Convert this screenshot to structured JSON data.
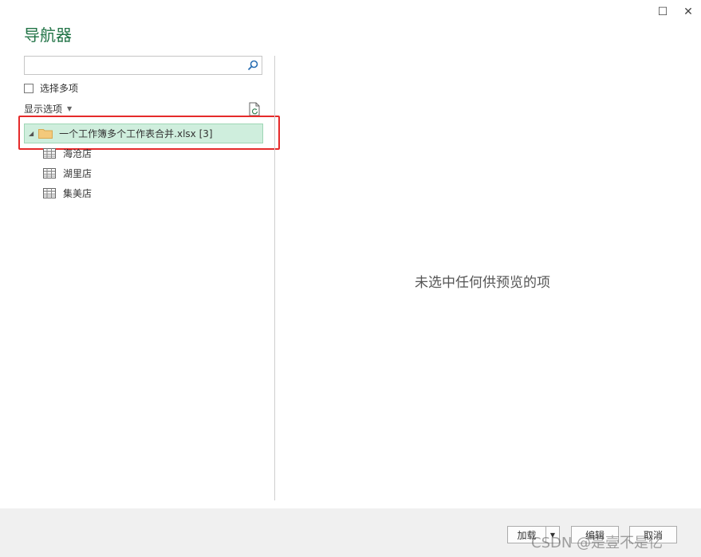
{
  "window": {
    "maximize_glyph": "☐",
    "close_glyph": "✕"
  },
  "title": "导航器",
  "search": {
    "value": "",
    "placeholder": ""
  },
  "select_multiple": {
    "label": "选择多项",
    "checked": false
  },
  "display_options": {
    "label": "显示选项"
  },
  "tree": {
    "root": {
      "label": "一个工作簿多个工作表合并.xlsx [3]",
      "expanded": true,
      "icon": "folder-icon"
    },
    "items": [
      {
        "label": "海沧店",
        "icon": "table-icon"
      },
      {
        "label": "湖里店",
        "icon": "table-icon"
      },
      {
        "label": "集美店",
        "icon": "table-icon"
      }
    ]
  },
  "preview": {
    "empty_message": "未选中任何供预览的项"
  },
  "buttons": {
    "load": "加载",
    "edit": "编辑",
    "cancel": "取消"
  },
  "watermark": "CSDN @是壹不是亿",
  "colors": {
    "accent": "#217346",
    "selected_bg": "#cfeedd",
    "highlight_border": "#e52a2a"
  }
}
